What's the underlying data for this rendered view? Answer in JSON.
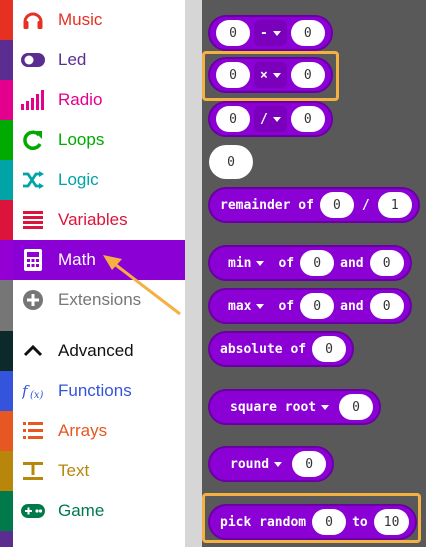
{
  "toolbox": {
    "categories": [
      {
        "label": "Music",
        "color": "#e63022",
        "icon": "headphones-icon"
      },
      {
        "label": "Led",
        "color": "#5c2d91",
        "icon": "toggle-icon"
      },
      {
        "label": "Radio",
        "color": "#e3008c",
        "icon": "signal-bars-icon"
      },
      {
        "label": "Loops",
        "color": "#00aa00",
        "icon": "loop-arrow-icon"
      },
      {
        "label": "Logic",
        "color": "#00a4a6",
        "icon": "shuffle-icon"
      },
      {
        "label": "Variables",
        "color": "#dc143c",
        "icon": "list-lines-icon"
      },
      {
        "label": "Math",
        "color": "#9400d3",
        "icon": "calculator-icon"
      },
      {
        "label": "Extensions",
        "color": "#767676",
        "icon": "plus-circle-icon"
      },
      {
        "label": "Advanced",
        "color": "#000000",
        "icon": "chevron-up-icon"
      },
      {
        "label": "Functions",
        "color": "#3455db",
        "icon": "function-icon"
      },
      {
        "label": "Arrays",
        "color": "#e65722",
        "icon": "list-icon"
      },
      {
        "label": "Text",
        "color": "#b8860b",
        "icon": "text-icon"
      },
      {
        "label": "Game",
        "color": "#007a4b",
        "icon": "gamepad-icon"
      }
    ],
    "selected": "Math"
  },
  "flyout": {
    "minus_block": {
      "left": "0",
      "op": "-",
      "right": "0"
    },
    "times_block": {
      "left": "0",
      "op": "×",
      "right": "0"
    },
    "divide_block": {
      "left": "0",
      "op": "/",
      "right": "0"
    },
    "number_block": {
      "value": "0"
    },
    "remainder_block": {
      "label": "remainder of",
      "left": "0",
      "sep": "/",
      "right": "1"
    },
    "min_block": {
      "op": "min",
      "of": "of",
      "left": "0",
      "and": "and",
      "right": "0"
    },
    "max_block": {
      "op": "max",
      "of": "of",
      "left": "0",
      "and": "and",
      "right": "0"
    },
    "absolute_block": {
      "label": "absolute of",
      "value": "0"
    },
    "sqrt_block": {
      "op": "square root",
      "value": "0"
    },
    "round_block": {
      "op": "round",
      "value": "0"
    },
    "random_block": {
      "label": "pick random",
      "from": "0",
      "to": "to",
      "max": "10"
    }
  },
  "colors": {
    "math": "#8b00d4",
    "highlight": "#f5b042",
    "flyout_bg": "#595959"
  }
}
